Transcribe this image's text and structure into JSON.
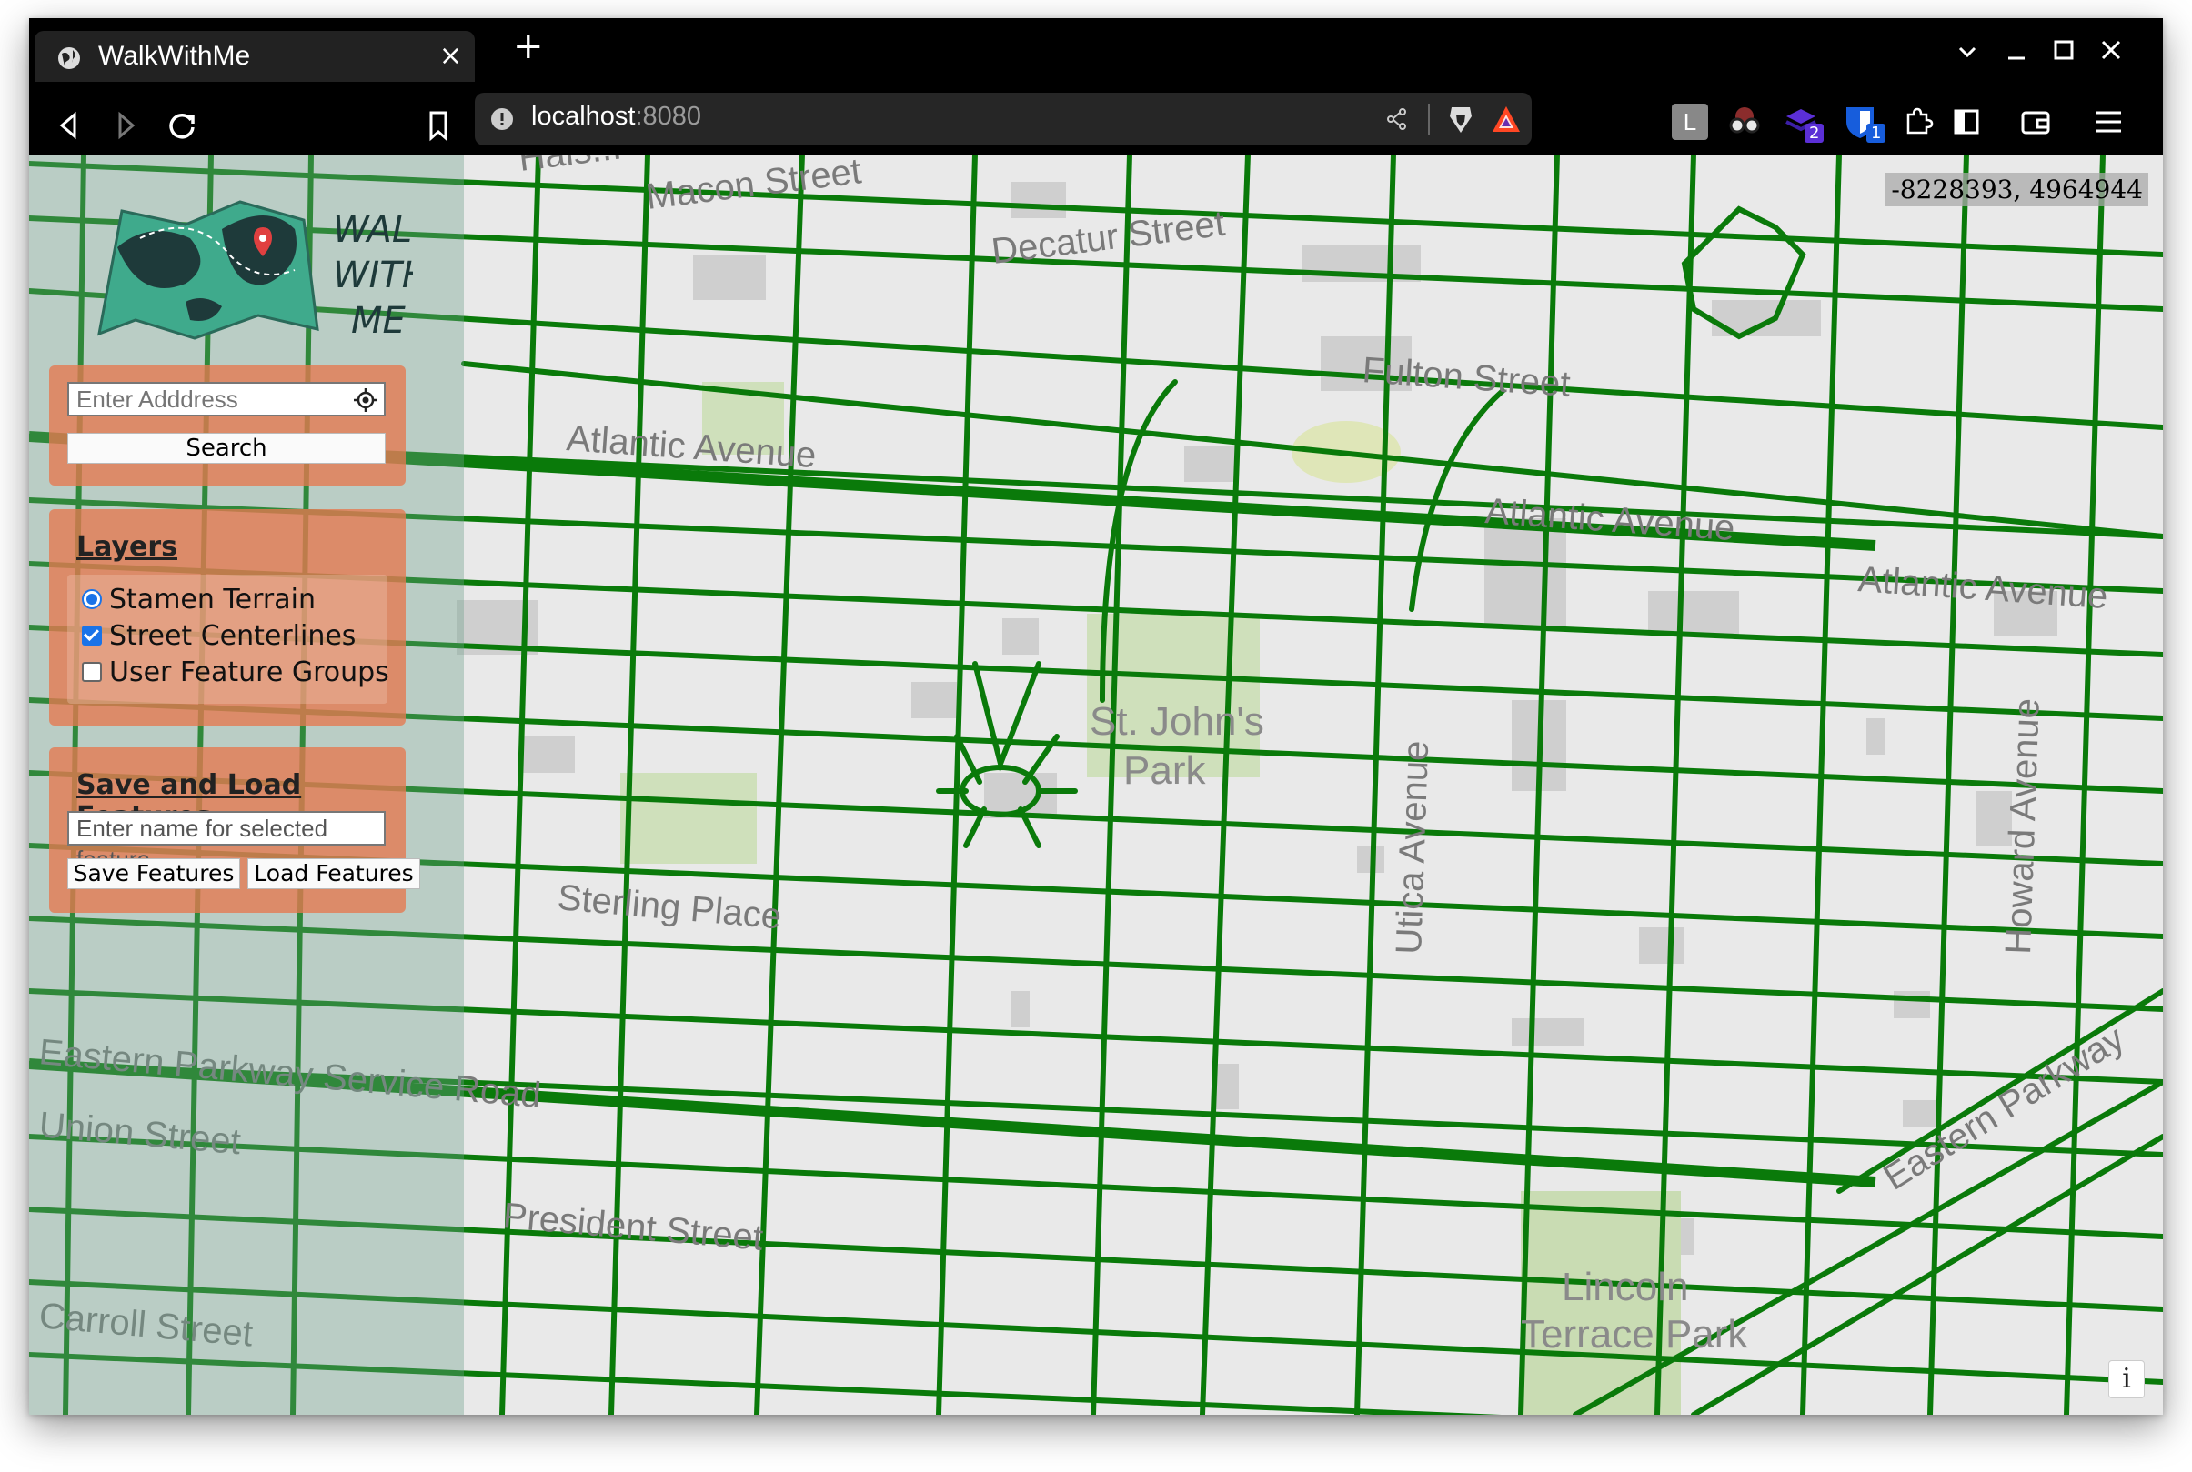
{
  "browser": {
    "tab_title": "WalkWithMe",
    "new_tab_symbol": "+",
    "close_tab_symbol": "×",
    "url_host": "localhost",
    "url_port": ":8080",
    "window_controls": [
      "chevron-down-icon",
      "minimize-icon",
      "maximize-icon",
      "close-icon"
    ],
    "extension_icons": [
      "extension-l-icon",
      "extension-glasses-icon",
      "extension-stack-icon",
      "extension-bitwarden-icon",
      "puzzle-icon",
      "sidebar-icon",
      "wallet-icon",
      "menu-icon"
    ],
    "extension_badges": {
      "stack": "2",
      "bitwarden": "1"
    },
    "extension_l_letter": "L"
  },
  "app": {
    "logo_text": [
      "WALK",
      "WITH",
      "ME"
    ],
    "search": {
      "placeholder": "Enter Adddress",
      "button": "Search"
    },
    "layers": {
      "heading": "Layers",
      "items": [
        {
          "label": "Stamen Terrain",
          "type": "radio",
          "checked": true
        },
        {
          "label": "Street Centerlines",
          "type": "checkbox",
          "checked": true
        },
        {
          "label": "User Feature Groups",
          "type": "checkbox",
          "checked": false
        }
      ]
    },
    "save_load": {
      "heading": "Save and Load Features",
      "placeholder": "Enter name for selected feature",
      "save_button": "Save Features",
      "load_button": "Load Features"
    }
  },
  "map": {
    "coordinates": "-8228393, 4964944",
    "info_button": "i",
    "labels": [
      "Macon Street",
      "Decatur Street",
      "Fulton Street",
      "Atlantic Avenue",
      "Atlantic Avenue",
      "Atlantic Avenue",
      "St. John's",
      "Park",
      "Utica Avenue",
      "Sterling Place",
      "Eastern Parkway Service Road",
      "Union Street",
      "President Street",
      "Lincoln",
      "Terrace Park",
      "Eastern Parkway",
      "Howard Avenue",
      "Carroll Street",
      "Hals..."
    ],
    "colors": {
      "streets": "#0a7a0a",
      "park": "#c9dcb3",
      "land": "#e9e9e9",
      "buildings": "#cfcfcf"
    }
  }
}
